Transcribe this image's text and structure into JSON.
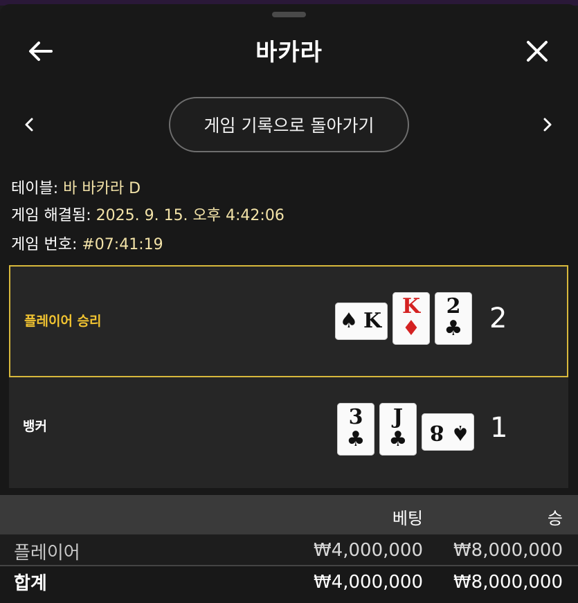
{
  "header": {
    "title": "바카라",
    "back_icon": "arrow-left-icon",
    "close_icon": "close-icon"
  },
  "nav": {
    "prev_icon": "chevron-left-icon",
    "next_icon": "chevron-right-icon",
    "back_to_history_label": "게임 기록으로 돌아가기"
  },
  "info": {
    "table_label": "테이블:",
    "table_value": "바 바카라 D",
    "resolved_label": "게임 해결됨:",
    "resolved_value": "2025. 9. 15. 오후 4:42:06",
    "number_label": "게임 번호:",
    "number_value": "#07:41:19"
  },
  "hands": {
    "player": {
      "label": "플레이어 승리",
      "score": "2",
      "cards": [
        {
          "rank": "K",
          "suit": "♠",
          "color": "black",
          "orientation": "side"
        },
        {
          "rank": "K",
          "suit": "♦",
          "color": "red",
          "orientation": "up"
        },
        {
          "rank": "2",
          "suit": "♣",
          "color": "black",
          "orientation": "up"
        }
      ]
    },
    "banker": {
      "label": "뱅커",
      "score": "1",
      "cards": [
        {
          "rank": "3",
          "suit": "♣",
          "color": "black",
          "orientation": "up"
        },
        {
          "rank": "J",
          "suit": "♣",
          "color": "black",
          "orientation": "up"
        },
        {
          "rank": "8",
          "suit": "♠",
          "color": "black",
          "orientation": "side"
        }
      ]
    }
  },
  "bets": {
    "col_bet": "베팅",
    "col_win": "승",
    "rows": [
      {
        "name": "플레이어",
        "bet": "₩4,000,000",
        "win": "₩8,000,000"
      }
    ],
    "total": {
      "name": "합계",
      "bet": "₩4,000,000",
      "win": "₩8,000,000"
    }
  },
  "colors": {
    "accent_gold": "#d8b93c",
    "winner_label": "#f2c431",
    "info_value": "#f3e3a8",
    "red_suit": "#d42222"
  }
}
